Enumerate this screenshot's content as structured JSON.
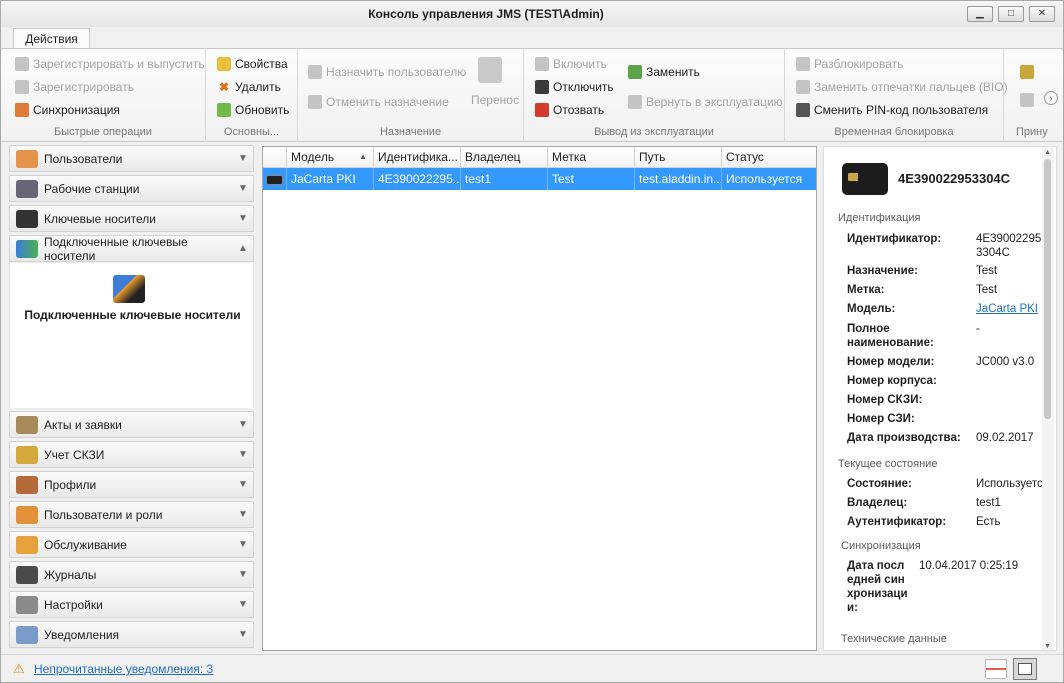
{
  "window": {
    "title": "Консоль управления JMS (TEST\\Admin)"
  },
  "tabs": [
    "Действия"
  ],
  "ribbon": {
    "groups": [
      {
        "label": "Быстрые операции",
        "items": [
          "Зарегистрировать и выпустить",
          "Зарегистрировать",
          "Синхронизация"
        ]
      },
      {
        "label": "Основны...",
        "items": [
          "Свойства",
          "Удалить",
          "Обновить"
        ]
      },
      {
        "label": "Назначение",
        "items": [
          "Назначить пользователю",
          "Отменить назначение",
          "Перенос"
        ]
      },
      {
        "label": "Вывод из эксплуатации",
        "items": [
          "Включить",
          "Отключить",
          "Отозвать",
          "Заменить",
          "Вернуть в эксплуатацию"
        ]
      },
      {
        "label": "Временная блокировка",
        "items": [
          "Разблокировать",
          "Заменить отпечатки пальцев (BIO)",
          "Сменить PIN-код пользователя"
        ]
      },
      {
        "label": "Прину"
      }
    ]
  },
  "sidebar": {
    "top": [
      "Пользователи",
      "Рабочие станции",
      "Ключевые носители",
      "Подключенные ключевые носители"
    ],
    "selected_caption": "Подключенные ключевые носители",
    "bottom": [
      "Акты и заявки",
      "Учет СКЗИ",
      "Профили",
      "Пользователи и роли",
      "Обслуживание",
      "Журналы",
      "Настройки",
      "Уведомления"
    ]
  },
  "grid": {
    "columns": [
      "Модель",
      "Идентифика...",
      "Владелец",
      "Метка",
      "Путь",
      "Статус"
    ],
    "rows": [
      [
        "JaCarta PKI",
        "4E390022295...",
        "test1",
        "Test",
        "test.aladdin.in...",
        "Используется"
      ]
    ]
  },
  "detail": {
    "header": "4E390022953304C",
    "sections": [
      {
        "title": "Идентификация",
        "fields": [
          {
            "k": "Идентификатор:",
            "v": "4E390022953304C"
          },
          {
            "k": "Назначение:",
            "v": "Test"
          },
          {
            "k": "Метка:",
            "v": "Test"
          },
          {
            "k": "Модель:",
            "v": "JaCarta PKI"
          },
          {
            "k": "Полное наименование:",
            "v": "-"
          },
          {
            "k": "Номер модели:",
            "v": "JC000 v3.0"
          },
          {
            "k": "Номер корпуса:",
            "v": ""
          },
          {
            "k": "Номер СКЗИ:",
            "v": ""
          },
          {
            "k": "Номер СЗИ:",
            "v": ""
          },
          {
            "k": "Дата производства:",
            "v": "09.02.2017"
          }
        ]
      },
      {
        "title": "Текущее состояние",
        "fields": [
          {
            "k": "Состояние:",
            "v": "Используется"
          },
          {
            "k": "Владелец:",
            "v": "test1"
          },
          {
            "k": "Аутентификатор:",
            "v": "Есть"
          }
        ]
      },
      {
        "title": "Синхронизация",
        "fields": [
          {
            "k": "Дата последней синхронизации:",
            "v": "10.04.2017 0:25:19"
          }
        ]
      },
      {
        "title": "Технические данные"
      }
    ]
  },
  "status": {
    "notifications": "Непрочитанные уведомления: 3"
  }
}
